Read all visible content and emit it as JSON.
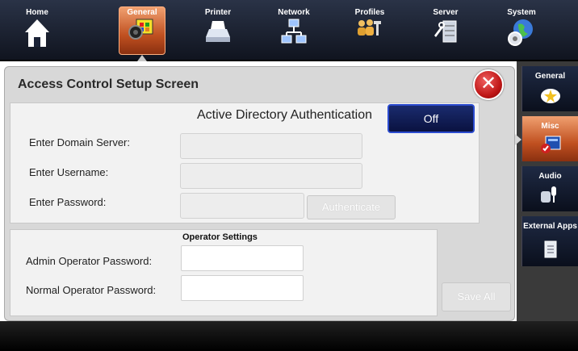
{
  "topnav": {
    "items": [
      {
        "label": "Home",
        "icon": "home-icon"
      },
      {
        "label": "General",
        "icon": "speaker-palette-icon",
        "active": true
      },
      {
        "label": "Printer",
        "icon": "printer-icon"
      },
      {
        "label": "Network",
        "icon": "network-icon"
      },
      {
        "label": "Profiles",
        "icon": "profiles-icon"
      },
      {
        "label": "Server",
        "icon": "server-icon"
      },
      {
        "label": "System",
        "icon": "globe-gear-icon"
      }
    ]
  },
  "screen": {
    "title": "Access Control Setup Screen",
    "close_icon": "close-icon"
  },
  "active_directory": {
    "title": "Active Directory Authentication",
    "toggle_label": "Off",
    "domain_label": "Enter Domain Server:",
    "domain_value": "",
    "username_label": "Enter Username:",
    "username_value": "",
    "password_label": "Enter Password:",
    "password_value": "",
    "authenticate_label": "Authenticate"
  },
  "operator": {
    "title": "Operator Settings",
    "admin_label": "Admin Operator Password:",
    "admin_value": "",
    "normal_label": "Normal Operator Password:",
    "normal_value": ""
  },
  "save_all_label": "Save All",
  "sidebar": {
    "items": [
      {
        "label": "General",
        "icon": "star-icon"
      },
      {
        "label": "Misc",
        "icon": "misc-icon",
        "active": true
      },
      {
        "label": "Audio",
        "icon": "microphone-icon"
      },
      {
        "label": "External Apps",
        "icon": "document-icon"
      }
    ]
  },
  "colors": {
    "accent_active": "#c05020",
    "toggle_bg": "#0a1240",
    "close_red": "#c01818"
  }
}
